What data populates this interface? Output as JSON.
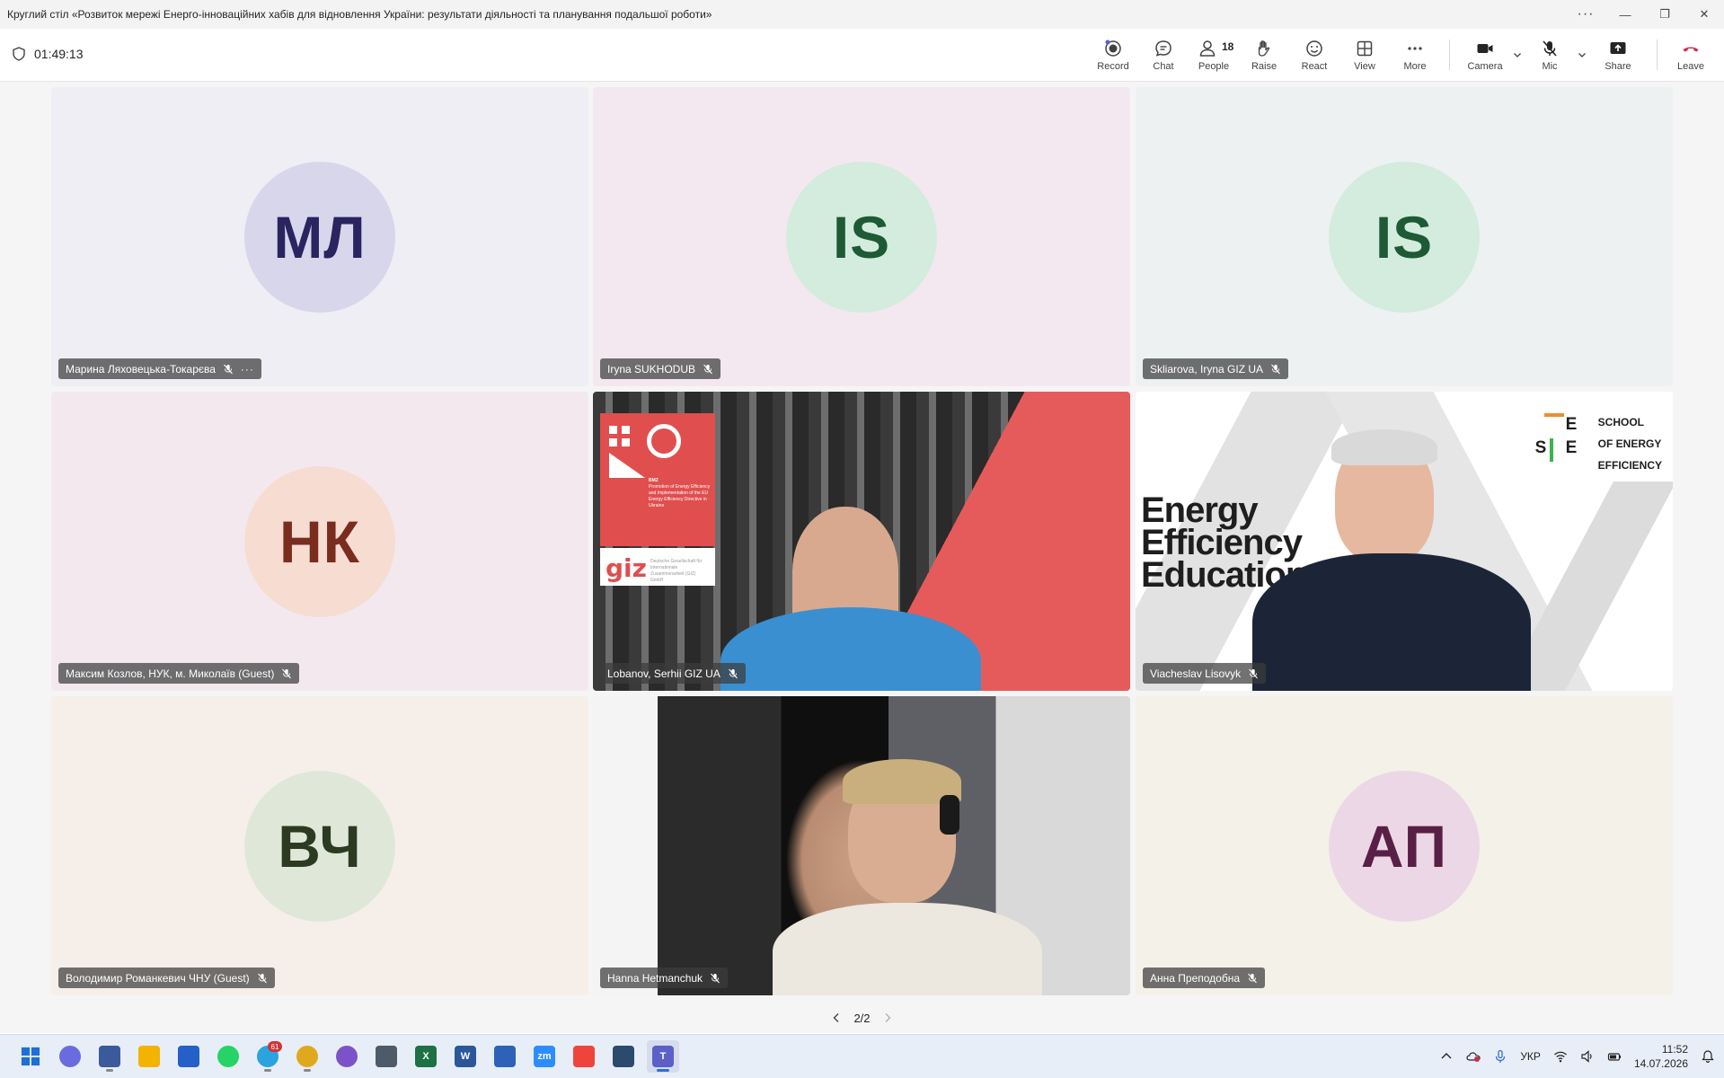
{
  "window": {
    "title": "Круглий стіл «Розвиток мережі Енерго-інноваційних хабів для відновлення України: результати діяльності та планування подальшої роботи»",
    "more_glyph": "···",
    "minimize_glyph": "—",
    "restore_glyph": "❐",
    "close_glyph": "✕"
  },
  "meeting": {
    "timer": "01:49:13"
  },
  "toolbar": {
    "record": "Record",
    "chat": "Chat",
    "people": "People",
    "people_count": "18",
    "raise": "Raise",
    "react": "React",
    "view": "View",
    "more": "More",
    "camera": "Camera",
    "mic": "Mic",
    "share": "Share",
    "leave": "Leave"
  },
  "tiles": [
    {
      "name": "Марина Ляховецька-Токарєва",
      "initials": "МЛ",
      "avatar_bg": "#d8d6eb",
      "avatar_fg": "#2a2460",
      "tile_bg": "#eeeef4",
      "muted": true,
      "has_more": true,
      "more_glyph": "···"
    },
    {
      "name": "Iryna SUKHODUB",
      "initials": "IS",
      "avatar_bg": "#d3ecdd",
      "avatar_fg": "#1d5a35",
      "tile_bg": "#f3e8f0",
      "muted": true
    },
    {
      "name": "Skliarova, Iryna GIZ UA",
      "initials": "IS",
      "avatar_bg": "#d3ecdd",
      "avatar_fg": "#1d5a35",
      "tile_bg": "#edf1f2",
      "muted": true
    },
    {
      "name": "Максим Козлов, НУК, м. Миколаїв (Guest)",
      "initials": "НК",
      "avatar_bg": "#f7dcd2",
      "avatar_fg": "#7a2c1f",
      "tile_bg": "#f4e8ef",
      "muted": true
    },
    {
      "name": "Lobanov, Serhii GIZ UA",
      "video": true,
      "muted": true
    },
    {
      "name": "Viacheslav Lisovyk",
      "video": true,
      "muted": true
    },
    {
      "name": "Володимир Романкевич ЧНУ (Guest)",
      "initials": "ВЧ",
      "avatar_bg": "#dfe8d8",
      "avatar_fg": "#2c3a22",
      "tile_bg": "#f6efe9",
      "muted": true
    },
    {
      "name": "Hanna Hetmanchuk",
      "video": true,
      "muted": true
    },
    {
      "name": "Анна Преподобна",
      "initials": "АП",
      "avatar_bg": "#ecd7e6",
      "avatar_fg": "#5a1f46",
      "tile_bg": "#f4f1e8",
      "muted": true
    }
  ],
  "video_overlays": {
    "giz": {
      "logo": "giz",
      "bmz": "BMZ",
      "caption": "Promotion of Energy Efficiency and Implementation of the EU Energy Efficiency Directive in Ukraine",
      "org": "Deutsche Gesellschaft für Internationale Zusammenarbeit (GIZ) GmbH"
    },
    "school": {
      "mark_e1": "E",
      "mark_s": "S",
      "mark_e2": "E",
      "line1": "SCHOOL",
      "line2": "OF ENERGY",
      "line3": "EFFICIENCY",
      "ee_line1": "Energy",
      "ee_line2": "Efficiency",
      "ee_line3": "Education"
    }
  },
  "pager": {
    "label": "2/2"
  },
  "taskbar": {
    "apps": [
      {
        "id": "start",
        "color": "#1f6fd6",
        "label": ""
      },
      {
        "id": "copilot",
        "color": "#6b6be0",
        "label": ""
      },
      {
        "id": "cleanup",
        "color": "#3a5a9c",
        "label": ""
      },
      {
        "id": "explorer",
        "color": "#f2b400",
        "label": ""
      },
      {
        "id": "save",
        "color": "#2460c8",
        "label": ""
      },
      {
        "id": "whatsapp",
        "color": "#25d366",
        "label": ""
      },
      {
        "id": "telegram",
        "color": "#2aa3e0",
        "label": "",
        "badge": "61"
      },
      {
        "id": "chrome",
        "color": "#e0a81c",
        "label": ""
      },
      {
        "id": "viber",
        "color": "#7d52c8",
        "label": ""
      },
      {
        "id": "calculator",
        "color": "#4d5a6a",
        "label": ""
      },
      {
        "id": "excel",
        "color": "#1e7145",
        "label": "X"
      },
      {
        "id": "word",
        "color": "#2b579a",
        "label": "W"
      },
      {
        "id": "sketch",
        "color": "#2e62b8",
        "label": ""
      },
      {
        "id": "zoom",
        "color": "#2d8cff",
        "label": "zm"
      },
      {
        "id": "anydesk",
        "color": "#ef443b",
        "label": ""
      },
      {
        "id": "globe",
        "color": "#2c4a6e",
        "label": ""
      },
      {
        "id": "teams",
        "color": "#5b5fc7",
        "label": "T",
        "active": true
      }
    ],
    "lang": "УКР",
    "time": "11:52",
    "date": "14.07.2026"
  }
}
